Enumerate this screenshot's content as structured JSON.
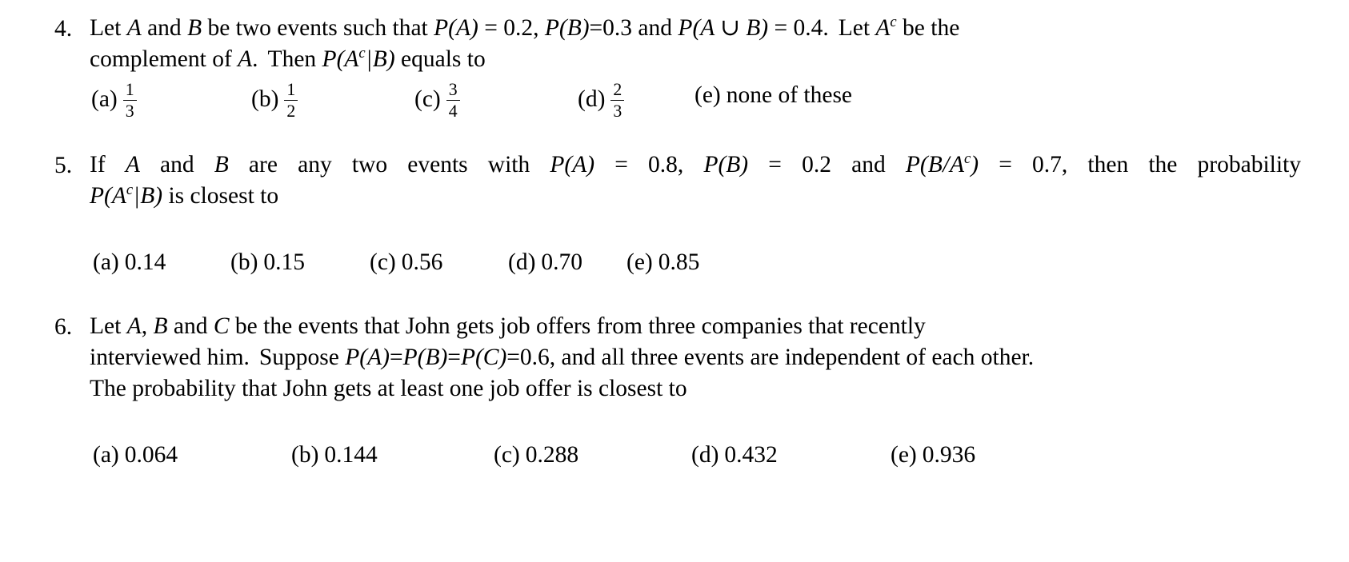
{
  "document": {
    "type": "multiple-choice-problem-set",
    "problems": [
      {
        "number": "4.",
        "stem_line1_part1": "Let ",
        "stem_A": "A",
        "stem_line1_part2": " and ",
        "stem_B": "B",
        "stem_line1_part3": " be two events such that ",
        "stem_PA": "P",
        "stem_PA_arg": "(A)",
        "stem_eq1": " = 0.2, ",
        "stem_PB": "P",
        "stem_PB_arg": "(B)",
        "stem_eq2": "=0.3 and ",
        "stem_PAuB": "P",
        "stem_PAuB_arg": "(A ∪ B)",
        "stem_eq3": " = 0.4.",
        "stem_line1_tail": "Let ",
        "stem_Ac": "A",
        "stem_Ac_sup": "c",
        "stem_line1_end": " be the",
        "stem_line2_part1": "complement of ",
        "stem_line2_A": "A",
        "stem_line2_part2": ".",
        "stem_line2_part3": "Then ",
        "stem_line2_P": "P",
        "stem_line2_open": "(A",
        "stem_line2_sup": "c",
        "stem_line2_bar": "|",
        "stem_line2_close": "B)",
        "stem_line2_end": " equals to",
        "options": [
          {
            "label": "(a)",
            "type": "fraction",
            "numerator": "1",
            "denominator": "3"
          },
          {
            "label": "(b)",
            "type": "fraction",
            "numerator": "1",
            "denominator": "2"
          },
          {
            "label": "(c)",
            "type": "fraction",
            "numerator": "3",
            "denominator": "4"
          },
          {
            "label": "(d)",
            "type": "fraction",
            "numerator": "2",
            "denominator": "3"
          },
          {
            "label": "(e)",
            "type": "text",
            "text": "none of these"
          }
        ]
      },
      {
        "number": "5.",
        "stem_line1_part1": "If ",
        "stem_A": "A",
        "stem_line1_part2": " and ",
        "stem_B": "B",
        "stem_line1_part3": " are any two events with ",
        "stem_PA": "P",
        "stem_PA_arg": "(A)",
        "stem_eq1": " = 0.8, ",
        "stem_PB": "P",
        "stem_PB_arg": "(B)",
        "stem_eq2": " = 0.2 and ",
        "stem_PBAc": "P",
        "stem_PBAc_open": "(B",
        "stem_PBAc_bar": "/",
        "stem_PBAc_A": "A",
        "stem_PBAc_sup": "c",
        "stem_PBAc_close": ")",
        "stem_eq3": " = 0.7, then the probability",
        "stem_line2_P": "P",
        "stem_line2_open": "(A",
        "stem_line2_sup": "c",
        "stem_line2_bar": "|",
        "stem_line2_close": "B)",
        "stem_line2_end": " is closest to",
        "options": [
          {
            "label": "(a)",
            "type": "text",
            "text": "0.14"
          },
          {
            "label": "(b)",
            "type": "text",
            "text": "0.15"
          },
          {
            "label": "(c)",
            "type": "text",
            "text": "0.56"
          },
          {
            "label": "(d)",
            "type": "text",
            "text": "0.70"
          },
          {
            "label": "(e)",
            "type": "text",
            "text": "0.85"
          }
        ]
      },
      {
        "number": "6.",
        "stem_line1_part1": "Let ",
        "stem_A": "A",
        "stem_line1_comma": ", ",
        "stem_B": "B",
        "stem_line1_part2": " and ",
        "stem_C": "C",
        "stem_line1_part3": " be the events that John gets job offers from three companies that recently",
        "stem_line2_part1": "interviewed him.",
        "stem_line2_part2": "Suppose ",
        "stem_line2_PA": "P",
        "stem_line2_PA_arg": "(A)",
        "stem_line2_eq1": "=",
        "stem_line2_PB": "P",
        "stem_line2_PB_arg": "(B)",
        "stem_line2_eq2": "=",
        "stem_line2_PC": "P",
        "stem_line2_PC_arg": "(C)",
        "stem_line2_eq3": "=0.6, and all three events are independent of each other.",
        "stem_line3": "The probability that John gets at least one job offer is closest to",
        "options": [
          {
            "label": "(a)",
            "type": "text",
            "text": "0.064"
          },
          {
            "label": "(b)",
            "type": "text",
            "text": "0.144"
          },
          {
            "label": "(c)",
            "type": "text",
            "text": "0.288"
          },
          {
            "label": "(d)",
            "type": "text",
            "text": "0.432"
          },
          {
            "label": "(e)",
            "type": "text",
            "text": "0.936"
          }
        ]
      }
    ]
  }
}
